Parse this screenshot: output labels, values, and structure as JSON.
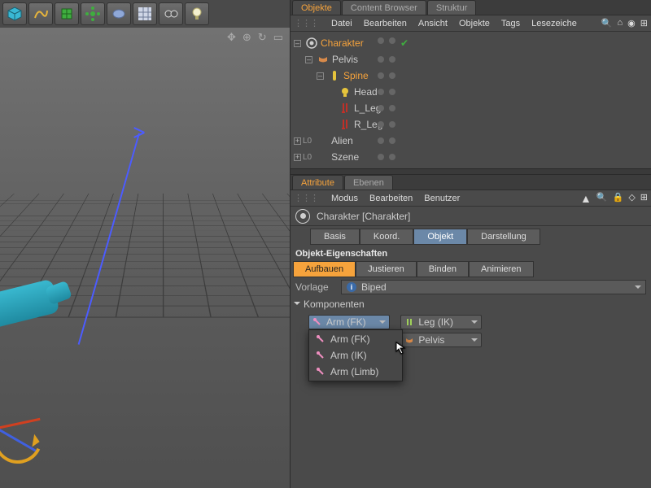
{
  "toolbar_icons": [
    "cube",
    "path",
    "cube-plus",
    "gear",
    "capsule",
    "grid",
    "glasses",
    "bulb"
  ],
  "objects_panel": {
    "tabs": [
      "Objekte",
      "Content Browser",
      "Struktur"
    ],
    "active_tab": 0,
    "menu": [
      "Datei",
      "Bearbeiten",
      "Ansicht",
      "Objekte",
      "Tags",
      "Lesezeiche"
    ],
    "tree": [
      {
        "name": "Charakter",
        "depth": 0,
        "orange": true,
        "exp": "minus",
        "icon": "char",
        "check": true
      },
      {
        "name": "Pelvis",
        "depth": 1,
        "orange": false,
        "exp": "minus",
        "icon": "pelvis"
      },
      {
        "name": "Spine",
        "depth": 2,
        "orange": true,
        "exp": "minus",
        "icon": "spine"
      },
      {
        "name": "Head",
        "depth": 3,
        "orange": false,
        "icon": "head"
      },
      {
        "name": "L_Leg",
        "depth": 3,
        "orange": false,
        "icon": "leg"
      },
      {
        "name": "R_Leg",
        "depth": 3,
        "orange": false,
        "icon": "leg"
      },
      {
        "name": "Alien",
        "depth": 0,
        "orange": false,
        "exp": "plus",
        "prefix": "L0"
      },
      {
        "name": "Szene",
        "depth": 0,
        "orange": false,
        "exp": "plus",
        "prefix": "L0"
      }
    ]
  },
  "attribute_panel": {
    "tabs": [
      "Attribute",
      "Ebenen"
    ],
    "active_tab": 0,
    "menu": [
      "Modus",
      "Bearbeiten",
      "Benutzer"
    ],
    "object_label": "Charakter [Charakter]",
    "subtabs": [
      "Basis",
      "Koord.",
      "Objekt",
      "Darstellung"
    ],
    "active_subtab": 2,
    "section_title": "Objekt-Eigenschaften",
    "modes": [
      "Aufbauen",
      "Justieren",
      "Binden",
      "Animieren"
    ],
    "active_mode": 0,
    "template_label": "Vorlage",
    "template_value": "Biped",
    "components_label": "Komponenten",
    "chip_left": "Arm (FK)",
    "chip_right_top": "Leg (IK)",
    "chip_right_bottom": "Pelvis",
    "dropdown": [
      "Arm (FK)",
      "Arm (IK)",
      "Arm (Limb)"
    ]
  }
}
